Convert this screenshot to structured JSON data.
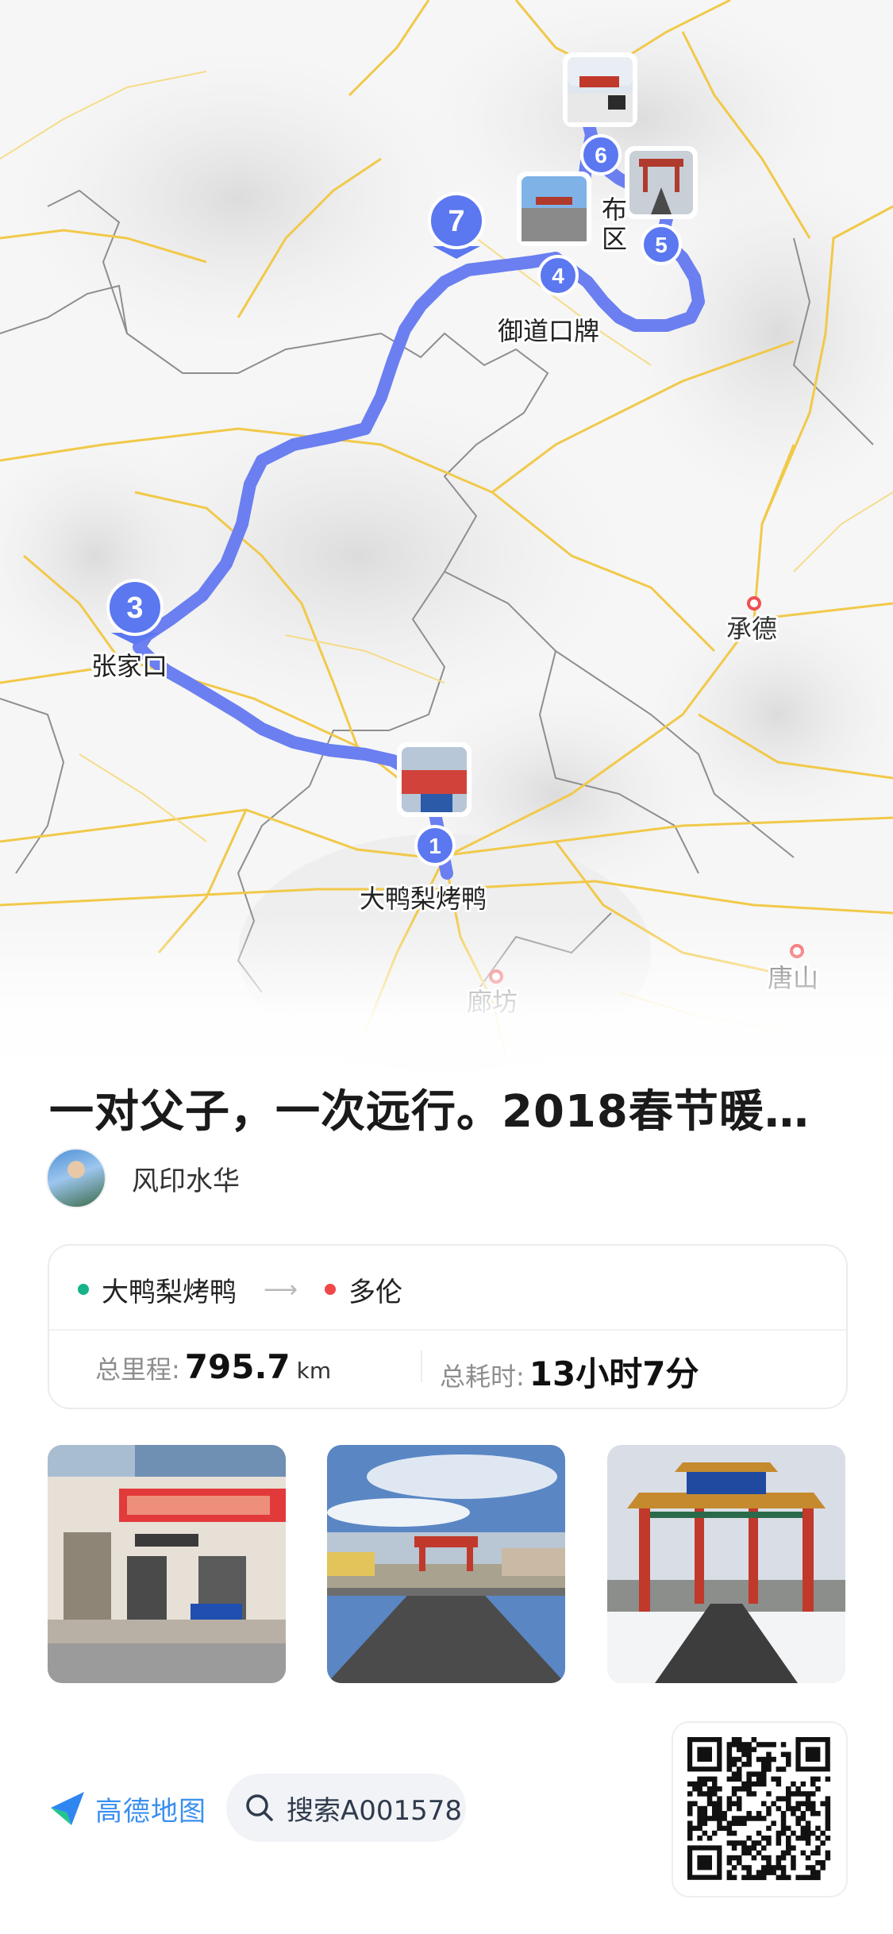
{
  "map": {
    "place_labels": [
      "张家口",
      "大鸭梨烤鸭",
      "御道口牌",
      "承德",
      "廊坊",
      "唐山",
      "布",
      "区"
    ],
    "waypoints": [
      "1",
      "3",
      "4",
      "5",
      "6",
      "7"
    ],
    "route_color": "#6b7ff0"
  },
  "trip": {
    "title": "一对父子，一次远行。2018春节暖…",
    "author": "风印水华"
  },
  "route": {
    "start": "大鸭梨烤鸭",
    "end": "多伦",
    "distance_label": "总里程:",
    "distance_value": "795.7",
    "distance_unit": "km",
    "duration_label": "总耗时:",
    "duration_value": "13小时7分"
  },
  "footer": {
    "logo_text": "高德地图",
    "search_text": "搜索A001578"
  },
  "icons": [
    "map-pin-icon",
    "arrow-right-icon",
    "amap-logo-icon",
    "search-icon",
    "qr-code-icon"
  ]
}
